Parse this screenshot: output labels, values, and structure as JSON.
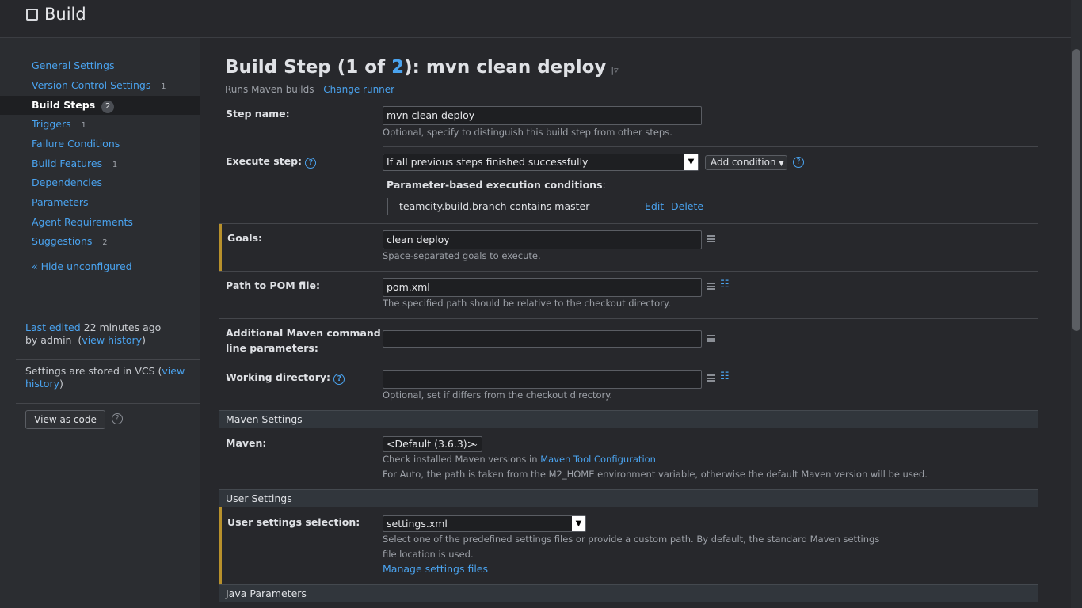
{
  "header": {
    "title": "Build"
  },
  "sidebar": {
    "items": [
      {
        "label": "General Settings",
        "badge": ""
      },
      {
        "label": "Version Control Settings",
        "badge": "1"
      },
      {
        "label": "Build Steps",
        "badge": "2"
      },
      {
        "label": "Triggers",
        "badge": "1"
      },
      {
        "label": "Failure Conditions",
        "badge": ""
      },
      {
        "label": "Build Features",
        "badge": "1"
      },
      {
        "label": "Dependencies",
        "badge": ""
      },
      {
        "label": "Parameters",
        "badge": ""
      },
      {
        "label": "Agent Requirements",
        "badge": ""
      },
      {
        "label": "Suggestions",
        "badge": "2"
      }
    ],
    "hide_unconfigured": "« Hide unconfigured",
    "last_edited_link": "Last edited",
    "last_edited_time": "22 minutes ago",
    "by_admin": "by admin",
    "view_history": "view history",
    "vcs_text": "Settings are stored in VCS",
    "vcs_view": "view",
    "vcs_history": "history",
    "view_as_code": "View as code"
  },
  "main": {
    "title_prefix": "Build Step (1 of ",
    "title_num": "2",
    "title_suffix": "): mvn clean deploy",
    "runs": "Runs Maven builds",
    "change_runner": "Change runner",
    "step_name": {
      "label": "Step name:",
      "value": "mvn clean deploy",
      "hint": "Optional, specify to distinguish this build step from other steps."
    },
    "execute_step": {
      "label": "Execute step:",
      "value": "If all previous steps finished successfully",
      "add_condition": "Add condition",
      "param_title": "Parameter-based execution conditions",
      "condition": "teamcity.build.branch contains master",
      "edit": "Edit",
      "delete": "Delete"
    },
    "goals": {
      "label": "Goals:",
      "value": "clean deploy",
      "hint": "Space-separated goals to execute."
    },
    "pom": {
      "label": "Path to POM file:",
      "value": "pom.xml",
      "hint": "The specified path should be relative to the checkout directory."
    },
    "additional": {
      "label_line1": "Additional Maven command",
      "label_line2": "line parameters:",
      "value": ""
    },
    "working_dir": {
      "label": "Working directory:",
      "value": "",
      "hint": "Optional, set if differs from the checkout directory."
    },
    "maven_section": "Maven Settings",
    "maven": {
      "label": "Maven:",
      "value": "<Default (3.6.3)>",
      "hint1_prefix": "Check installed Maven versions in",
      "hint1_link": "Maven Tool Configuration",
      "hint2": "For Auto, the path is taken from the M2_HOME environment variable, otherwise the default Maven version will be used."
    },
    "user_section": "User Settings",
    "user_settings": {
      "label": "User settings selection:",
      "value": "settings.xml",
      "hint": "Select one of the predefined settings files or provide a custom path. By default, the standard Maven settings file location is used.",
      "manage": "Manage settings files"
    },
    "java_section": "Java Parameters"
  }
}
